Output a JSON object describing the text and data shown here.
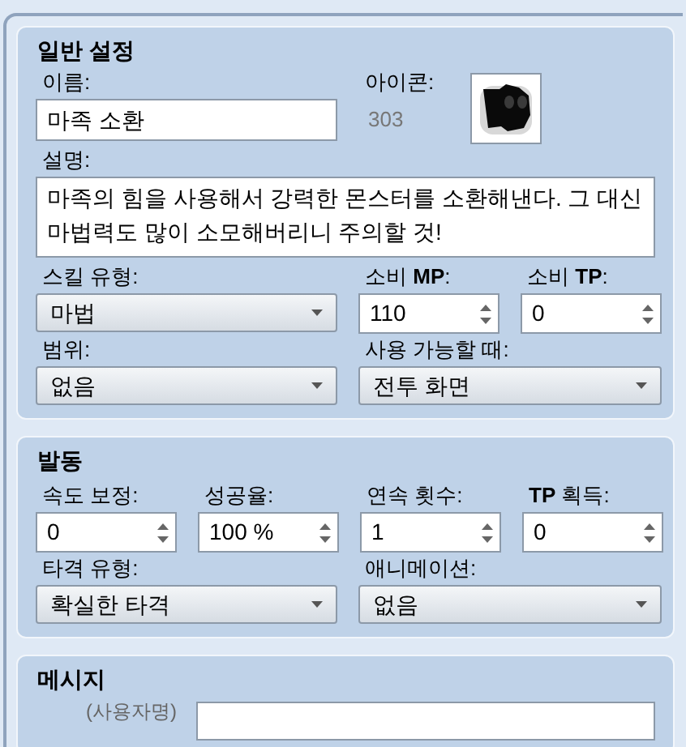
{
  "general": {
    "title": "일반 설정",
    "name": {
      "label": "이름:",
      "value": "마족 소환"
    },
    "icon": {
      "label": "아이콘:",
      "index": "303"
    },
    "description": {
      "label": "설명:",
      "value": "마족의 힘을 사용해서 강력한 몬스터를 소환해낸다. 그 대신 마법력도 많이 소모해버리니 주의할 것!"
    },
    "row1": [
      {
        "kind": "select",
        "label": "스킬 유형:",
        "value": "마법"
      },
      {
        "kind": "spin",
        "label": "소비 **MP**:",
        "value": "110"
      },
      {
        "kind": "spin",
        "label": "소비 **TP**:",
        "value": "0"
      }
    ],
    "row2": [
      {
        "kind": "select",
        "label": "범위:",
        "value": "없음"
      },
      {
        "kind": "select",
        "label": "사용 가능할 때:",
        "value": "전투 화면"
      }
    ]
  },
  "invocation": {
    "title": "발동",
    "row1": [
      {
        "kind": "spin",
        "label": "속도 보정:",
        "value": "0"
      },
      {
        "kind": "spin",
        "label": "성공율:",
        "value": "100 %"
      },
      {
        "kind": "spin",
        "label": "연속 횟수:",
        "value": "1"
      },
      {
        "kind": "spin",
        "label": "**TP** 획득:",
        "value": "0"
      }
    ],
    "row2": [
      {
        "kind": "select",
        "label": "타격 유형:",
        "value": "확실한 타격"
      },
      {
        "kind": "select",
        "label": "애니메이션:",
        "value": "없음"
      }
    ]
  },
  "message": {
    "title": "메시지",
    "user_label": "(사용자명)"
  }
}
